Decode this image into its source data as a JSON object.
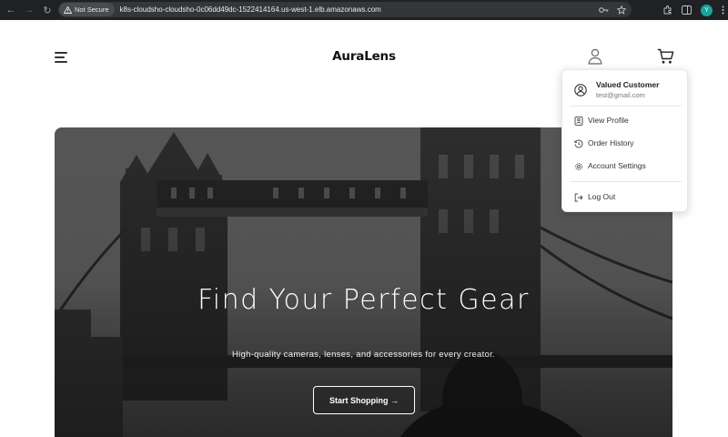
{
  "browser": {
    "security_label": "Not Secure",
    "url": "k8s-cloudsho-cloudsho-0c06dd49dc-1522414164.us-west-1.elb.amazonaws.com",
    "profile_initial": "Y"
  },
  "header": {
    "brand": "AuraLens"
  },
  "hero": {
    "title": "Find Your Perfect Gear",
    "subtitle": "High-quality cameras, lenses, and accessories for every creator.",
    "cta_label": "Start Shopping →"
  },
  "account_menu": {
    "name": "Valued Customer",
    "email": "test@gmail.com",
    "items": [
      {
        "label": "View Profile",
        "icon": "profile-icon"
      },
      {
        "label": "Order History",
        "icon": "history-icon"
      },
      {
        "label": "Account Settings",
        "icon": "gear-icon"
      },
      {
        "label": "Log Out",
        "icon": "logout-icon"
      }
    ]
  }
}
